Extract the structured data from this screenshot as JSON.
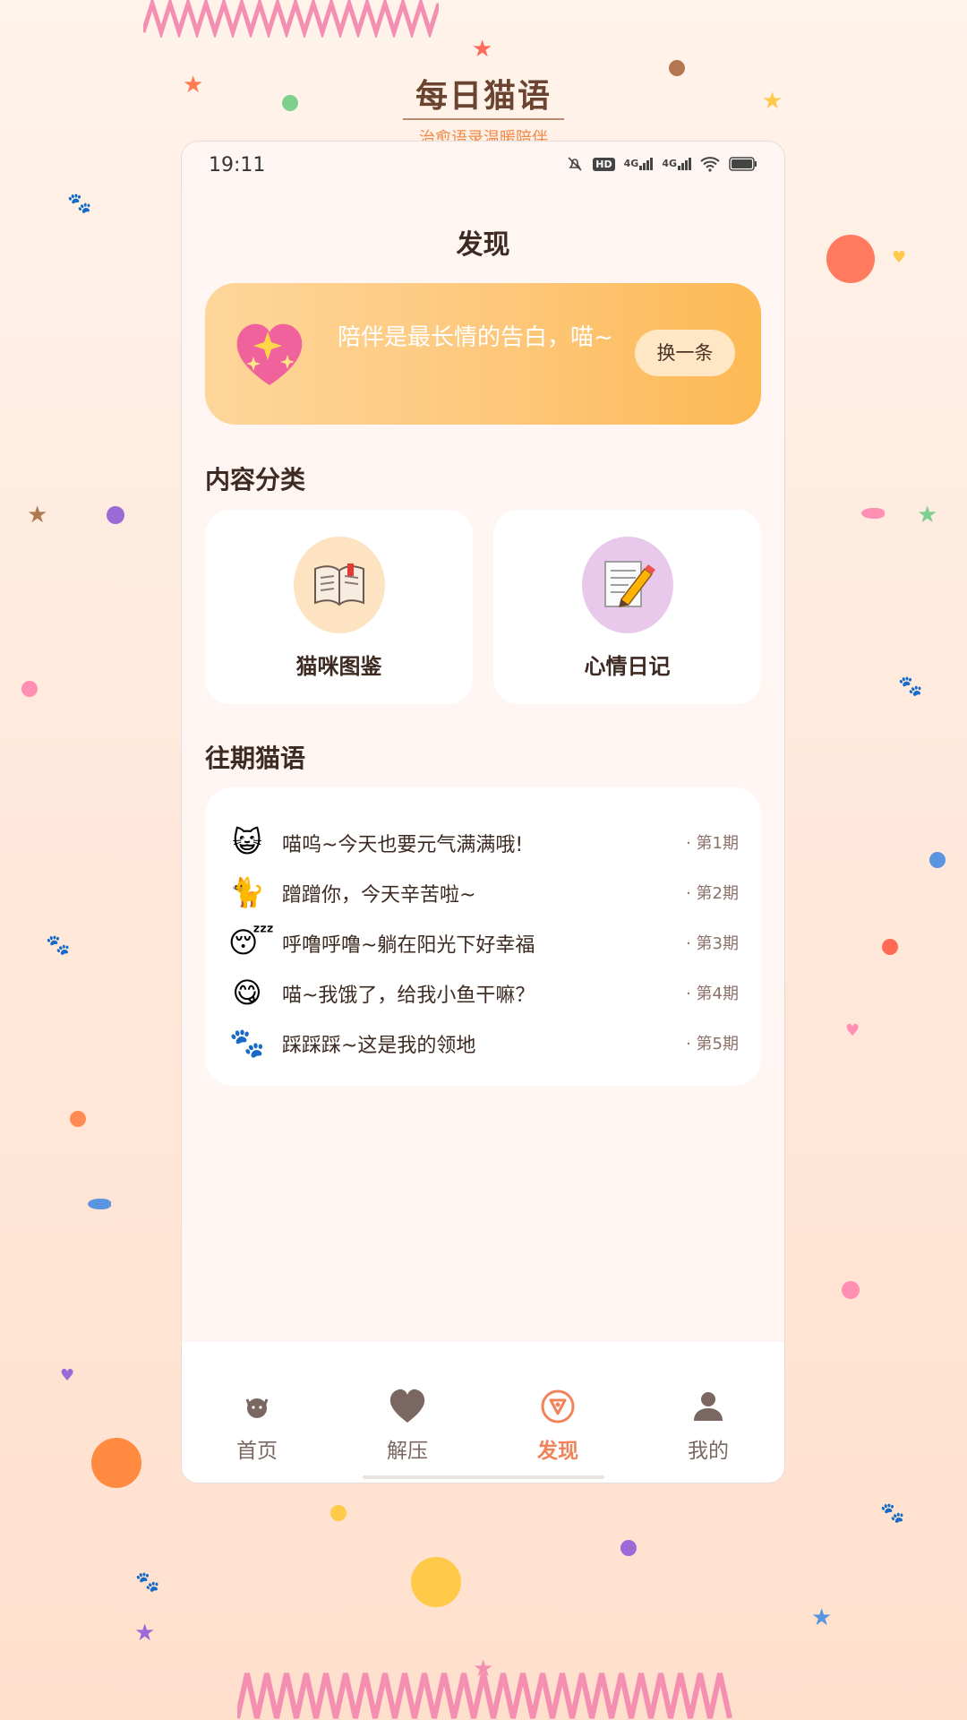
{
  "brand": {
    "title": "每日猫语",
    "subtitle": "治愈语录温暖陪伴"
  },
  "status_bar": {
    "time": "19:11",
    "network_left": "4G",
    "network_right": "4G",
    "hd": "HD"
  },
  "page": {
    "title": "发现"
  },
  "quote_card": {
    "icon": "sparkling-heart-icon",
    "text": "陪伴是最长情的告白，喵~",
    "refresh_label": "换一条"
  },
  "categories": {
    "title": "内容分类",
    "items": [
      {
        "label": "猫咪图鉴",
        "icon": "open-book-icon",
        "circle_color": "#fde3c2"
      },
      {
        "label": "心情日记",
        "icon": "memo-pencil-icon",
        "circle_color": "#e8c9eb"
      }
    ]
  },
  "history": {
    "title": "往期猫语",
    "items": [
      {
        "emoji": "😺",
        "icon": "smiling-cat-icon",
        "text": "喵呜~今天也要元气满满哦!",
        "issue": "· 第1期"
      },
      {
        "emoji": "🐈",
        "icon": "cat-icon",
        "text": "蹭蹭你，今天辛苦啦~",
        "issue": "· 第2期"
      },
      {
        "emoji": "😴",
        "icon": "sleeping-face-icon",
        "text": "呼噜呼噜~躺在阳光下好幸福",
        "issue": "· 第3期"
      },
      {
        "emoji": "😋",
        "icon": "yummy-face-icon",
        "text": "喵~我饿了，给我小鱼干嘛？",
        "issue": "· 第4期"
      },
      {
        "emoji": "🐾",
        "icon": "paw-prints-icon",
        "text": "踩踩踩~这是我的领地",
        "issue": "· 第5期"
      }
    ]
  },
  "tabbar": {
    "items": [
      {
        "label": "首页",
        "icon": "cat-face-icon",
        "active": false
      },
      {
        "label": "解压",
        "icon": "heart-icon",
        "active": false
      },
      {
        "label": "发现",
        "icon": "compass-icon",
        "active": true
      },
      {
        "label": "我的",
        "icon": "user-icon",
        "active": false
      }
    ],
    "active_color": "#f0835a",
    "inactive_color": "#7a6761"
  }
}
